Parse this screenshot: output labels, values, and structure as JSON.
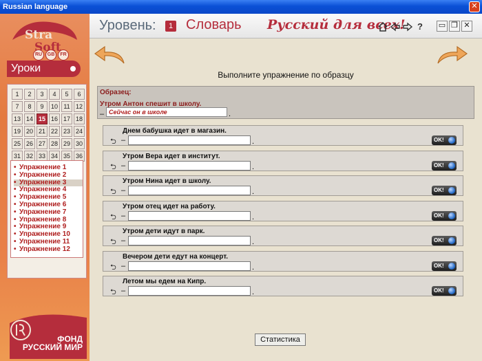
{
  "window": {
    "title": "Russian language",
    "close": "✕"
  },
  "sidebar": {
    "logo_top": "Stra",
    "logo_bottom": "Soft",
    "langs": [
      "RU",
      "GB",
      "FR"
    ],
    "lessons_label": "Уроки",
    "days": [
      "1",
      "2",
      "3",
      "4",
      "5",
      "6",
      "7",
      "8",
      "9",
      "10",
      "11",
      "12",
      "13",
      "14",
      "15",
      "16",
      "17",
      "18",
      "19",
      "20",
      "21",
      "22",
      "23",
      "24",
      "25",
      "26",
      "27",
      "28",
      "29",
      "30",
      "31",
      "32",
      "33",
      "34",
      "35",
      "36"
    ],
    "active_day": "15",
    "exercises": [
      "Упражнение  1",
      "Упражнение  2",
      "Упражнение  3",
      "Упражнение  4",
      "Упражнение  5",
      "Упражнение  6",
      "Упражнение  7",
      "Упражнение  8",
      "Упражнение  9",
      "Упражнение  10",
      "Упражнение  11",
      "Упражнение  12"
    ],
    "current_exercise_index": 2,
    "fond_line1": "ФОНД",
    "fond_line2": "РУССКИЙ МИР"
  },
  "header": {
    "level_label": "Уровень:",
    "level_number": "1",
    "section_title": "Словарь",
    "slogan": "Русский для всех!",
    "icons": [
      "home-icon",
      "back-icon",
      "forward-icon",
      "help-icon"
    ],
    "help": "?",
    "minimize": "▭",
    "restore": "❐",
    "close": "✕"
  },
  "main": {
    "instruction": "Выполните упражнение по образцу",
    "sample": {
      "label": "Образец:",
      "sentence": "Утром Антон спешит в школу.",
      "answer": "Сейчас он в школе"
    },
    "rows": [
      {
        "question": "Днем бабушка идет в магазин."
      },
      {
        "question": "Утром Вера идет в институт."
      },
      {
        "question": "Утром Нина идет в школу."
      },
      {
        "question": "Утром отец идет на работу."
      },
      {
        "question": "Утром дети идут в парк."
      },
      {
        "question": "Вечером дети едут на концерт."
      },
      {
        "question": "Летом мы едем на Кипр."
      }
    ],
    "ok_label": "OK!",
    "stats_label": "Статистика"
  }
}
